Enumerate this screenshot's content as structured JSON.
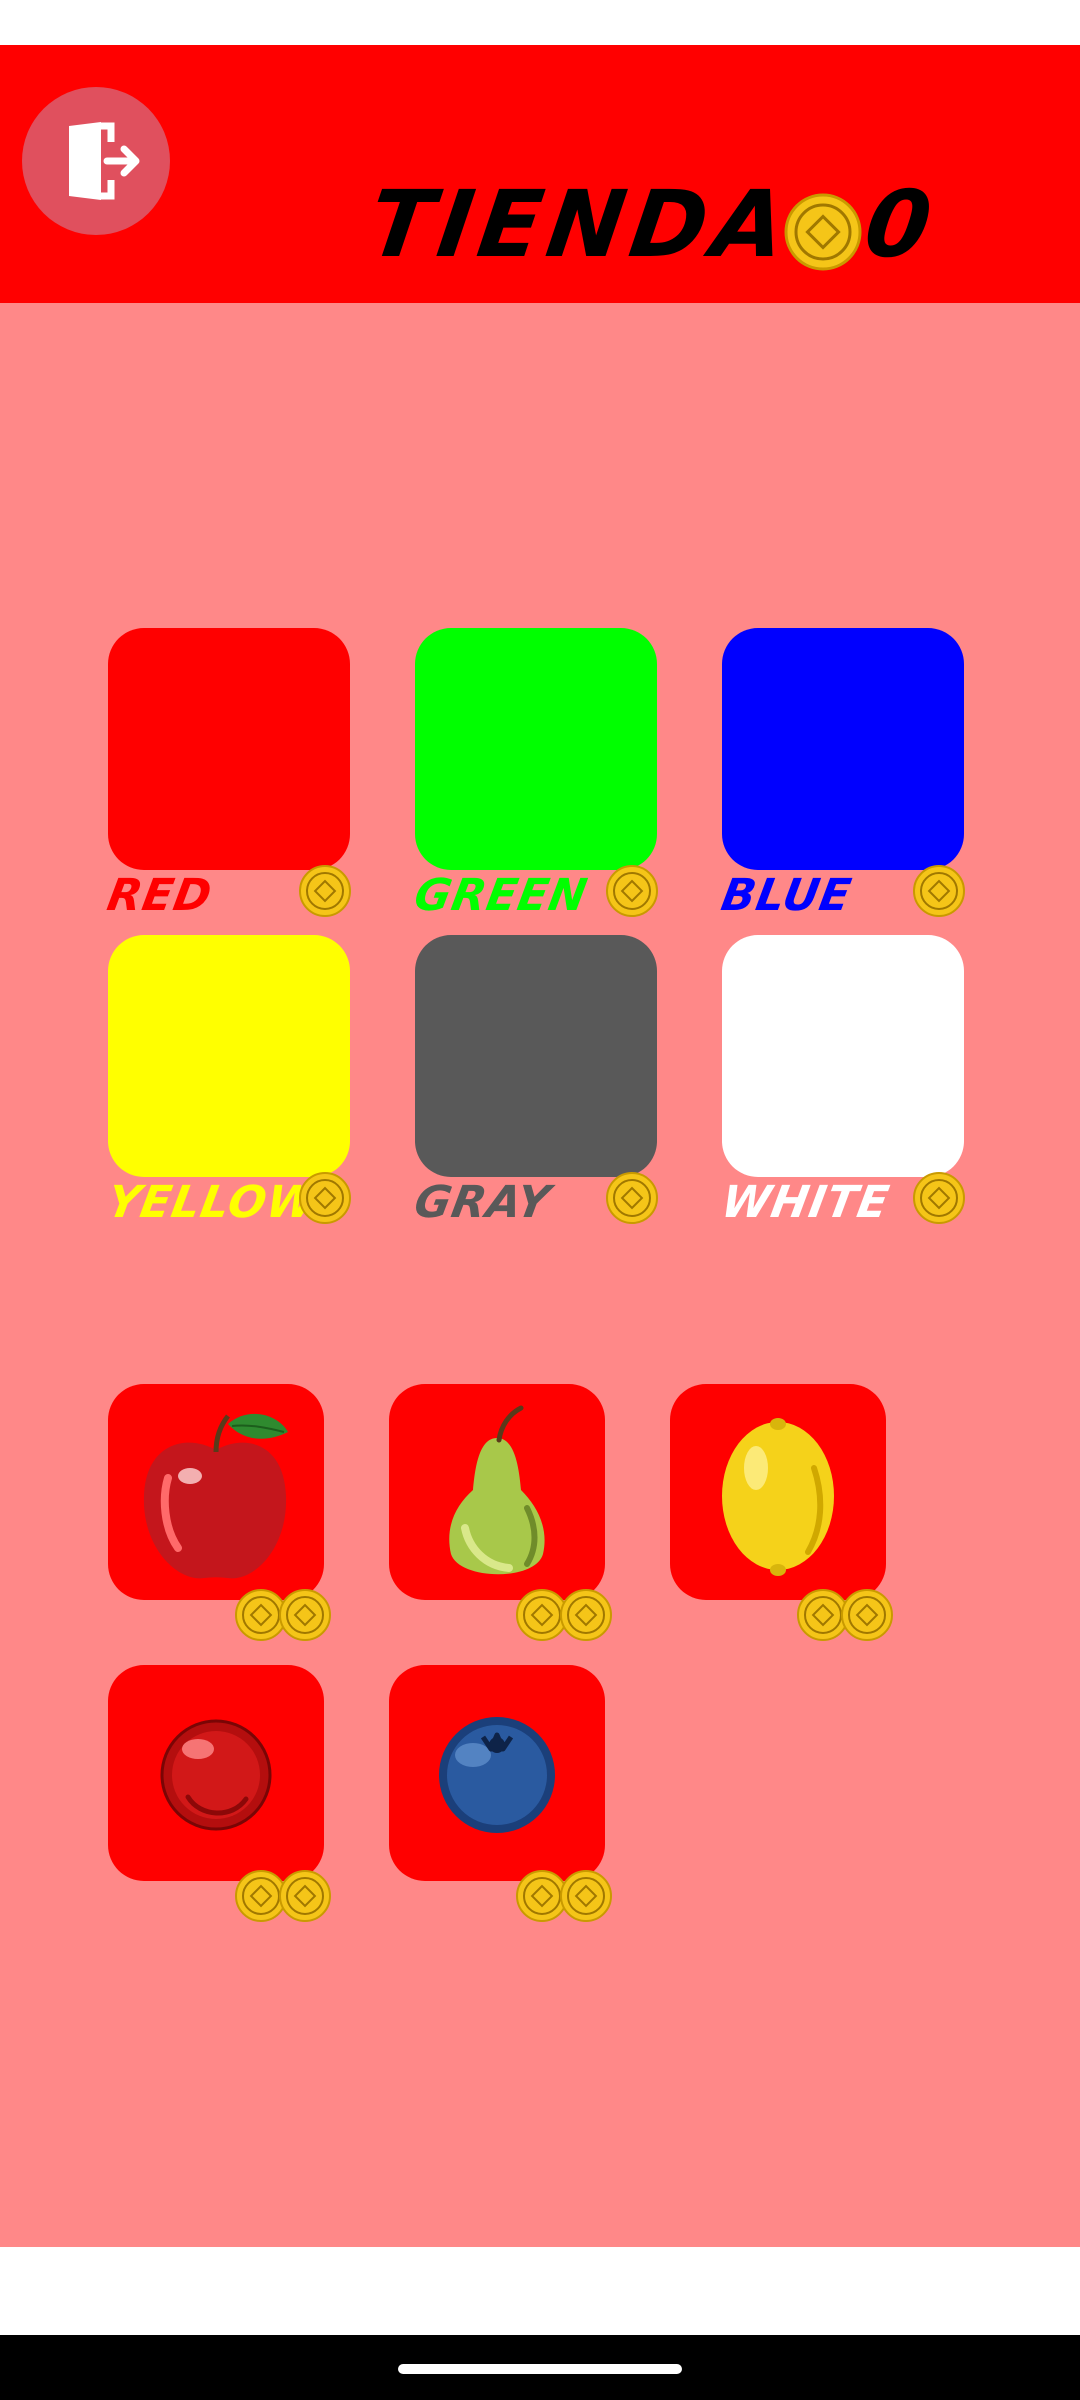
{
  "header": {
    "title": "TIENDA",
    "coin_count": "0",
    "exit_icon": "exit-door-icon"
  },
  "colors_section": {
    "items": [
      {
        "label": "RED",
        "swatch_color": "#ff0000",
        "label_color": "#ff0000"
      },
      {
        "label": "GREEN",
        "swatch_color": "#00ff00",
        "label_color": "#00ff00"
      },
      {
        "label": "BLUE",
        "swatch_color": "#0000ff",
        "label_color": "#0000ff"
      },
      {
        "label": "YELLOW",
        "swatch_color": "#ffff00",
        "label_color": "#ffff00"
      },
      {
        "label": "GRAY",
        "swatch_color": "#595959",
        "label_color": "#595959"
      },
      {
        "label": "WHITE",
        "swatch_color": "#ffffff",
        "label_color": "#ffffff"
      }
    ]
  },
  "fruits_section": {
    "items": [
      {
        "name": "apple",
        "icon": "apple-icon"
      },
      {
        "name": "pear",
        "icon": "pear-icon"
      },
      {
        "name": "lemon",
        "icon": "lemon-icon"
      },
      {
        "name": "cherry",
        "icon": "cherry-icon"
      },
      {
        "name": "blueberry",
        "icon": "blueberry-icon"
      }
    ]
  },
  "colors": {
    "header_bg": "#ff0000",
    "main_bg": "#ff8888",
    "coin_gold": "#f5c518"
  }
}
